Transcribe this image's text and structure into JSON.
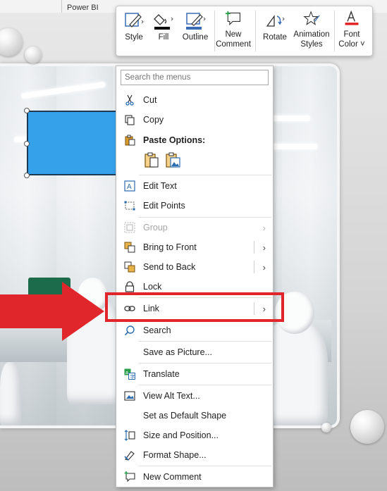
{
  "ribbon": {
    "partial_label": "Power BI"
  },
  "mini_toolbar": {
    "items": [
      {
        "label": "Style",
        "icon": "style-brush-icon"
      },
      {
        "label": "Fill",
        "icon": "fill-bucket-icon"
      },
      {
        "label": "Outline",
        "icon": "outline-pen-icon"
      },
      {
        "label": "New Comment",
        "line1": "New",
        "line2": "Comment",
        "icon": "new-comment-icon"
      },
      {
        "label": "Rotate",
        "icon": "rotate-icon"
      },
      {
        "label": "Animation Styles",
        "line1": "Animation",
        "line2": "Styles",
        "icon": "animation-star-icon"
      },
      {
        "label": "Font Color",
        "line1": "Font",
        "line2": "Color ˅",
        "icon": "font-color-icon"
      }
    ],
    "fill_color": "#000000",
    "font_color": "#e02020"
  },
  "context_menu": {
    "search_placeholder": "Search the menus",
    "cut": "Cut",
    "copy": "Copy",
    "paste_options": "Paste Options:",
    "edit_text": "Edit Text",
    "edit_points": "Edit Points",
    "group": "Group",
    "bring_to_front": "Bring to Front",
    "send_to_back": "Send to Back",
    "lock": "Lock",
    "link": "Link",
    "search": "Search",
    "save_as_picture": "Save as Picture...",
    "translate": "Translate",
    "view_alt_text": "View Alt Text...",
    "set_default_shape": "Set as Default Shape",
    "size_and_position": "Size and Position...",
    "format_shape": "Format Shape...",
    "new_comment": "New Comment"
  },
  "colors": {
    "shape_fill": "#35a1ea",
    "highlight_red": "#e0252b",
    "menu_icon_blue": "#2b6cb0"
  }
}
